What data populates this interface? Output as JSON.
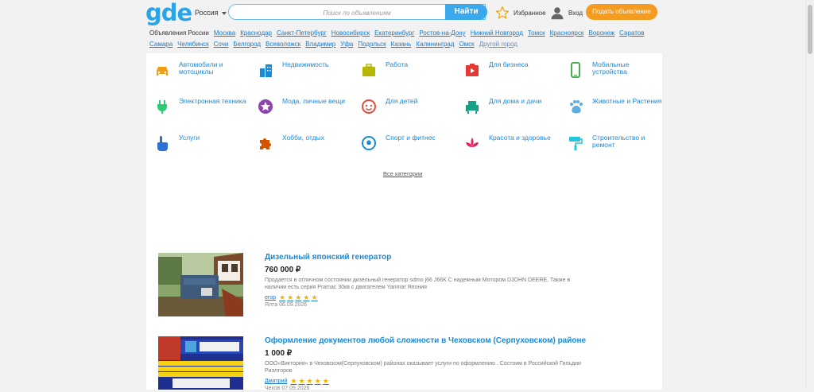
{
  "header": {
    "logo": "gde",
    "region": "Россия",
    "search_placeholder": "Поиск по объявлениям",
    "search_button": "Найти",
    "favorites": "Избранное",
    "login": "Вход",
    "post_ad": "Подать объявление"
  },
  "cities": {
    "lead": "Объявления России",
    "row1": [
      "Москва",
      "Краснодар",
      "Санкт-Петербург",
      "Новосибирск",
      "Екатеринбург",
      "Ростов-на-Дону",
      "Нижний Новгород",
      "Томск",
      "Красноярск",
      "Воронеж",
      "Саратов"
    ],
    "row2": [
      "Самара",
      "Челябинск",
      "Сочи",
      "Белгород",
      "Всеволожск",
      "Владимир",
      "Уфа",
      "Подольск",
      "Казань",
      "Калининград",
      "Омск"
    ],
    "other": "Другой город"
  },
  "categories": [
    {
      "label": "Автомобили и мотоциклы",
      "icon": "car-icon",
      "color": "#f39c12"
    },
    {
      "label": "Недвижимость",
      "icon": "buildings-icon",
      "color": "#1a8ad6"
    },
    {
      "label": "Работа",
      "icon": "briefcase-icon",
      "color": "#b5b800"
    },
    {
      "label": "Для бизнеса",
      "icon": "business-icon",
      "color": "#e53935"
    },
    {
      "label": "Мобильные устройства",
      "icon": "phone-icon",
      "color": "#4caf50"
    },
    {
      "label": "Электронная техника",
      "icon": "plug-icon",
      "color": "#2ecc71"
    },
    {
      "label": "Мода, личные вещи",
      "icon": "star-badge-icon",
      "color": "#8e44ad"
    },
    {
      "label": "Для детей",
      "icon": "child-face-icon",
      "color": "#e74c3c"
    },
    {
      "label": "Для дома и дачи",
      "icon": "armchair-icon",
      "color": "#16a085"
    },
    {
      "label": "Животные и Растения",
      "icon": "paw-icon",
      "color": "#5dade2"
    },
    {
      "label": "Услуги",
      "icon": "hand-pointer-icon",
      "color": "#2e6fd1"
    },
    {
      "label": "Хобби, отдых",
      "icon": "puzzle-icon",
      "color": "#d35400"
    },
    {
      "label": "Спорт и фитнес",
      "icon": "ball-icon",
      "color": "#1a8ad6"
    },
    {
      "label": "Красота и здоровье",
      "icon": "lotus-icon",
      "color": "#e91e63"
    },
    {
      "label": "Строительство и ремонт",
      "icon": "paint-roller-icon",
      "color": "#26c6da"
    }
  ],
  "all_categories": "Все категории",
  "listings": [
    {
      "title": "Дизельный японский генератор",
      "price": "760 000 ₽",
      "desc": "Продается в отличном состоянии дизельный генератор sdmo j66 J66K С надежным Мотором DJOHN DEERE, Также в наличии есть серия Pramac 30кв с двигателем Yanmar Япония",
      "seller": "егор",
      "rating": 5,
      "meta": "Ялта 06.09.2026"
    },
    {
      "title": "Оформление документов любой сложности в Чеховском (Серпуховском) районе",
      "price": "1 000 ₽",
      "desc": "ООО«Виктория» в Чеховском(Серпуховском) районах оказывает услуги по оформлению . Состоим в Российской Гильдии Риэлторов",
      "seller": "Дмитрий",
      "rating": 5,
      "meta": "Чехов 07.09.2026"
    }
  ]
}
